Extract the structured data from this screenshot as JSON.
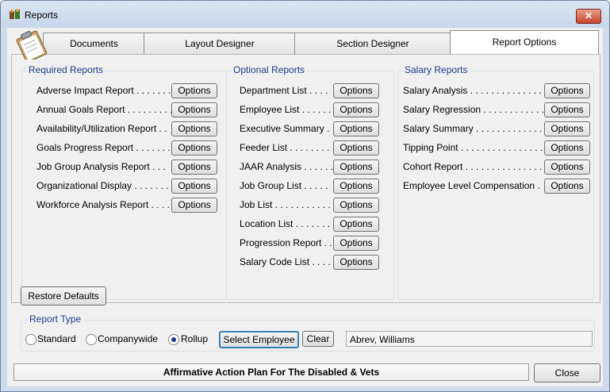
{
  "window": {
    "title": "Reports",
    "close_glyph": "✕"
  },
  "tabs": [
    "Documents",
    "Layout Designer",
    "Section Designer",
    "Report Options"
  ],
  "active_tab": "Report Options",
  "required": {
    "title": "Required Reports",
    "items": [
      {
        "label": "Adverse Impact Report",
        "dots": " . . . . . . ."
      },
      {
        "label": "Annual Goals Report",
        "dots": " . . . . . . . . ."
      },
      {
        "label": "Availability/Utilization Report",
        "dots": " . ."
      },
      {
        "label": "Goals Progress Report",
        "dots": " . . . . . . ."
      },
      {
        "label": "Job Group Analysis Report",
        "dots": " . . ."
      },
      {
        "label": "Organizational Display",
        "dots": " . . . . . . ."
      },
      {
        "label": "Workforce Analysis Report",
        "dots": " . . . ."
      }
    ]
  },
  "optional": {
    "title": "Optional Reports",
    "items": [
      {
        "label": "Department List",
        "dots": " . . . ."
      },
      {
        "label": "Employee List",
        "dots": " . . . . . ."
      },
      {
        "label": "Executive Summary",
        "dots": " . ."
      },
      {
        "label": "Feeder List",
        "dots": " . . . . . . . . . . ."
      },
      {
        "label": "JAAR Analysis",
        "dots": " . . . . . . ."
      },
      {
        "label": "Job Group List",
        "dots": " . . . . ."
      },
      {
        "label": "Job List",
        "dots": " . . . . . . . . . . . . ."
      },
      {
        "label": "Location List",
        "dots": " . . . . . . . ."
      },
      {
        "label": "Progression Report",
        "dots": " . . ."
      },
      {
        "label": "Salary Code List",
        "dots": " . . . . ."
      }
    ]
  },
  "salary": {
    "title": "Salary Reports",
    "items": [
      {
        "label": "Salary Analysis",
        "dots": " . . . . . . . . . . . . . . . ."
      },
      {
        "label": "Salary Regression",
        "dots": " . . . . . . . . . . . ."
      },
      {
        "label": "Salary Summary",
        "dots": " . . . . . . . . . . . . . . ."
      },
      {
        "label": "Tipping Point",
        "dots": " . . . . . . . . . . . . . . . . . ."
      },
      {
        "label": "Cohort Report",
        "dots": " . . . . . . . . . . . . . . . . . ."
      },
      {
        "label": "Employee Level Compensation",
        "dots": " ."
      }
    ]
  },
  "options_label": "Options",
  "restore_defaults": "Restore Defaults",
  "report_type": {
    "title": "Report Type",
    "options": [
      "Standard",
      "Companywide",
      "Rollup"
    ],
    "selected": "Rollup",
    "select_employee": "Select Employee",
    "clear": "Clear",
    "employee_value": "Abrev, Williams"
  },
  "status_text": "Affirmative Action Plan For The Disabled & Vets",
  "close_label": "Close",
  "icons": {
    "app": "reports-app-icon",
    "clipboard": "clipboard-icon"
  }
}
